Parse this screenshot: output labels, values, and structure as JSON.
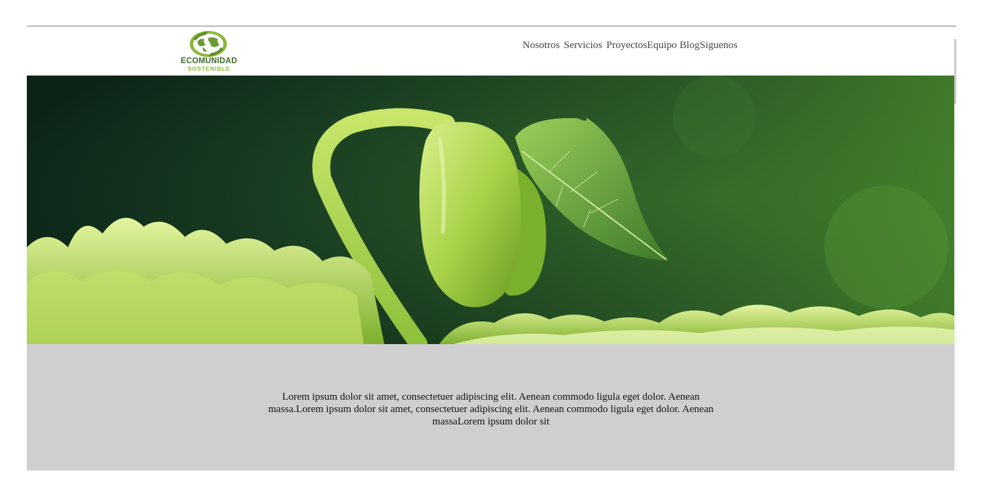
{
  "brand": {
    "name_line1": "ECOMUNIDAD",
    "name_line2": "SOSTENIBLE",
    "logo_icon": "globe-leaf-icon",
    "color_dark": "#3f6a2c",
    "color_light": "#8bb83a"
  },
  "nav": {
    "items": [
      {
        "label": "Nosotros"
      },
      {
        "label": "Servicios"
      },
      {
        "label": "Proyectos"
      },
      {
        "label": "Equipo"
      },
      {
        "label": "Blog"
      },
      {
        "label": "Siguenos"
      }
    ]
  },
  "hero": {
    "image": "seedling-sprout-photo"
  },
  "band": {
    "text": "Lorem ipsum dolor sit amet, consectetuer adipiscing elit. Aenean commodo ligula eget dolor. Aenean massa.Lorem ipsum dolor sit amet, consectetuer adipiscing elit. Aenean commodo ligula eget dolor. Aenean massaLorem ipsum dolor sit",
    "background": "#d0cfd0"
  }
}
